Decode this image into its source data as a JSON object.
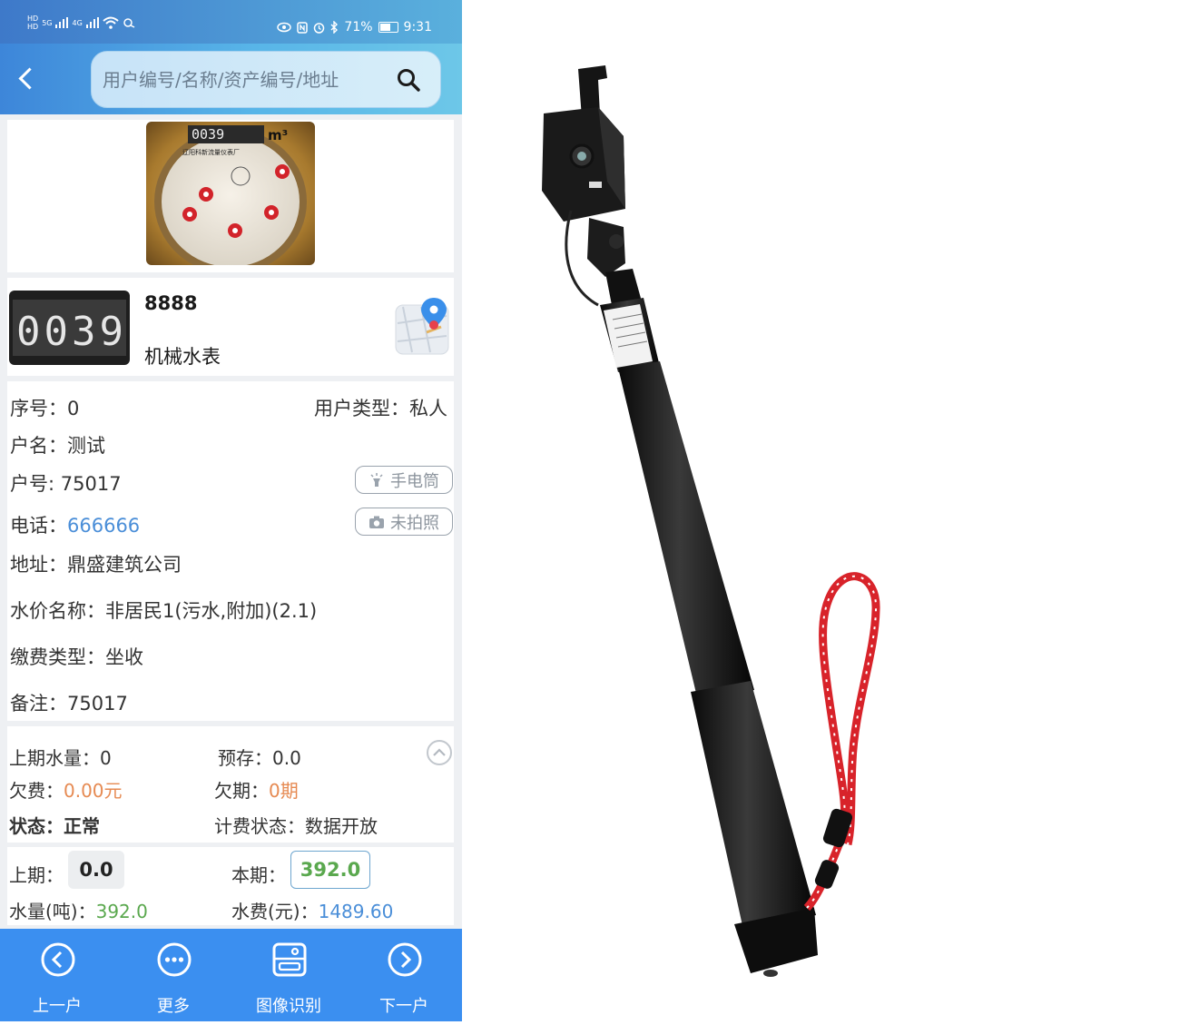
{
  "status_bar": {
    "left_text_1": "HD",
    "left_text_2": "HD",
    "signal_1": "5G",
    "signal_2": "4G",
    "wifi": "6",
    "battery": "71%",
    "time": "9:31",
    "battery_level": 0.71
  },
  "header": {
    "search_placeholder": "用户编号/名称/资产编号/地址"
  },
  "meter_photo": {
    "digits": "0039",
    "unit": "m³",
    "maker": "辽阳科新流量仪表厂"
  },
  "reading": {
    "thumb_digits": "0039",
    "meter_no": "8888",
    "meter_type": "机械水表"
  },
  "info": {
    "seq_label": "序号：",
    "seq_value": "0",
    "user_type_label": "用户类型：",
    "user_type_value": "私人",
    "name_label": "户名：",
    "name_value": "测试",
    "account_label": "户号: ",
    "account_value": "75017",
    "flashlight_label": "手电筒",
    "phone_label": "电话：",
    "phone_value": "666666",
    "photo_label": "未拍照",
    "address_label": "地址：",
    "address_value": "鼎盛建筑公司",
    "price_label": "水价名称：",
    "price_value": "非居民1(污水,附加)(2.1)",
    "pay_label": "缴费类型：",
    "pay_value": "坐收",
    "note_label": "备注：",
    "note_value": "75017"
  },
  "summary": {
    "prev_water_label": "上期水量：",
    "prev_water_value": "0",
    "prepaid_label": "预存：",
    "prepaid_value": "0.0",
    "arrears_label": "欠费：",
    "arrears_value": "0.00元",
    "arrears_period_label": "欠期：",
    "arrears_period_value": "0期",
    "status_label": "状态：",
    "status_value": "正常",
    "billing_label": "计费状态：",
    "billing_value": "数据开放"
  },
  "readings": {
    "prev_label": "上期：",
    "prev_value": "0.0",
    "cur_label": "本期：",
    "cur_value": "392.0",
    "water_label": "水量(吨)：",
    "water_value": "392.0",
    "fee_label": "水费(元)：",
    "fee_value": "1489.60"
  },
  "nav": {
    "prev": "上一户",
    "more": "更多",
    "ocr": "图像识别",
    "next": "下一户"
  },
  "colors": {
    "header": "#4a9ee0",
    "nav": "#3b8ff0",
    "blue_text": "#4a8ed8",
    "orange_text": "#e68a52",
    "green_text": "#5aa84e",
    "strap": "#d8232a"
  }
}
